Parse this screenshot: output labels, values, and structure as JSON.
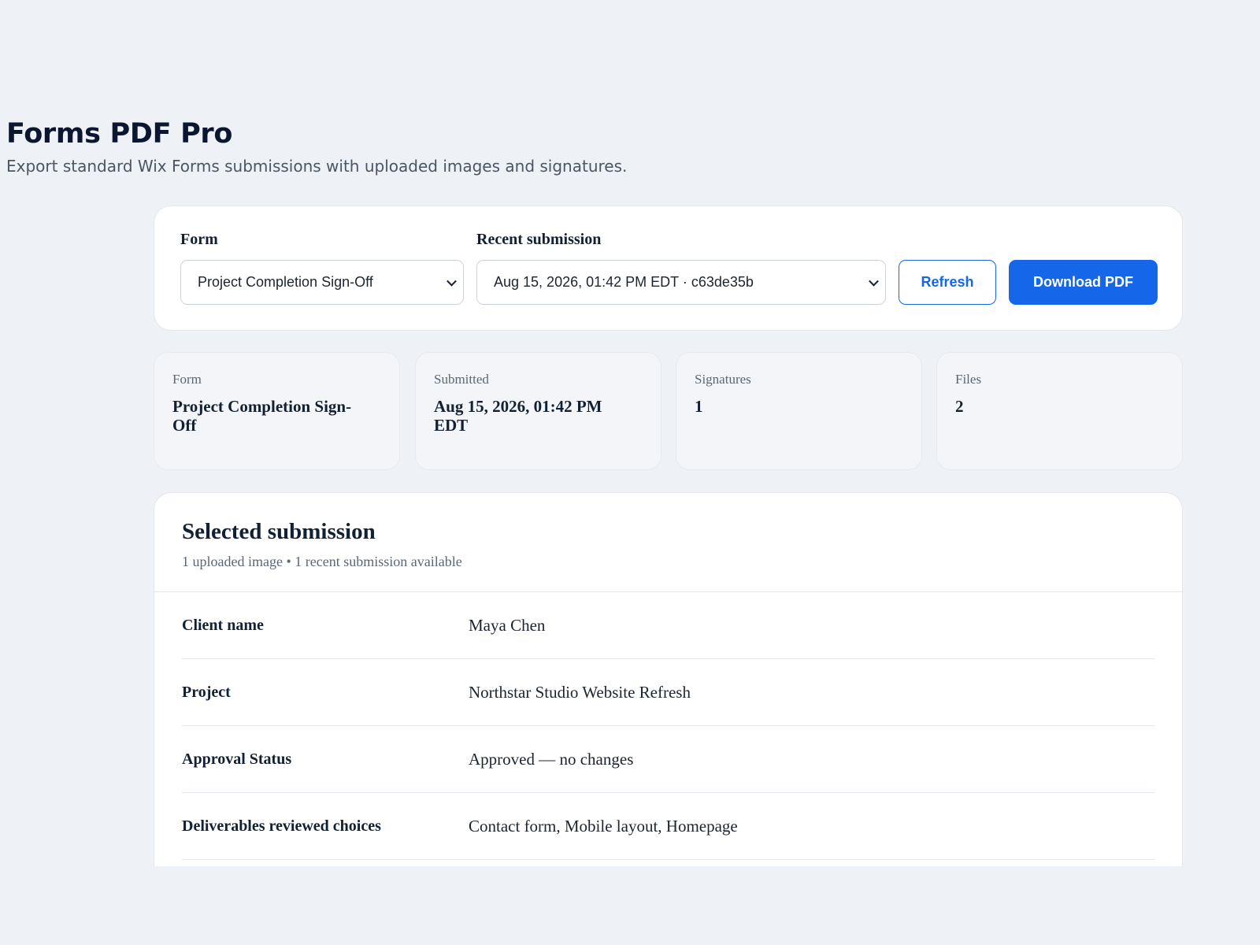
{
  "header": {
    "title": "Forms PDF Pro",
    "subtitle": "Export standard Wix Forms submissions with uploaded images and signatures."
  },
  "controls": {
    "form_label": "Form",
    "form_selected": "Project Completion Sign-Off",
    "submission_label": "Recent submission",
    "submission_selected": "Aug 15, 2026, 01:42 PM EDT · c63de35b",
    "refresh_label": "Refresh",
    "download_label": "Download PDF"
  },
  "stats": [
    {
      "label": "Form",
      "value": "Project Completion Sign-Off"
    },
    {
      "label": "Submitted",
      "value": "Aug 15, 2026, 01:42 PM EDT"
    },
    {
      "label": "Signatures",
      "value": "1"
    },
    {
      "label": "Files",
      "value": "2"
    }
  ],
  "details": {
    "title": "Selected submission",
    "meta": "1 uploaded image • 1 recent submission available",
    "fields": [
      {
        "label": "Client name",
        "value": "Maya Chen"
      },
      {
        "label": "Project",
        "value": "Northstar Studio Website Refresh"
      },
      {
        "label": "Approval Status",
        "value": "Approved — no changes"
      },
      {
        "label": "Deliverables reviewed choices",
        "value": "Contact form, Mobile layout, Homepage"
      }
    ]
  },
  "colors": {
    "accent": "#1566e8",
    "background": "#eef1f5",
    "card": "#ffffff",
    "stat_card": "#f3f5f8"
  }
}
